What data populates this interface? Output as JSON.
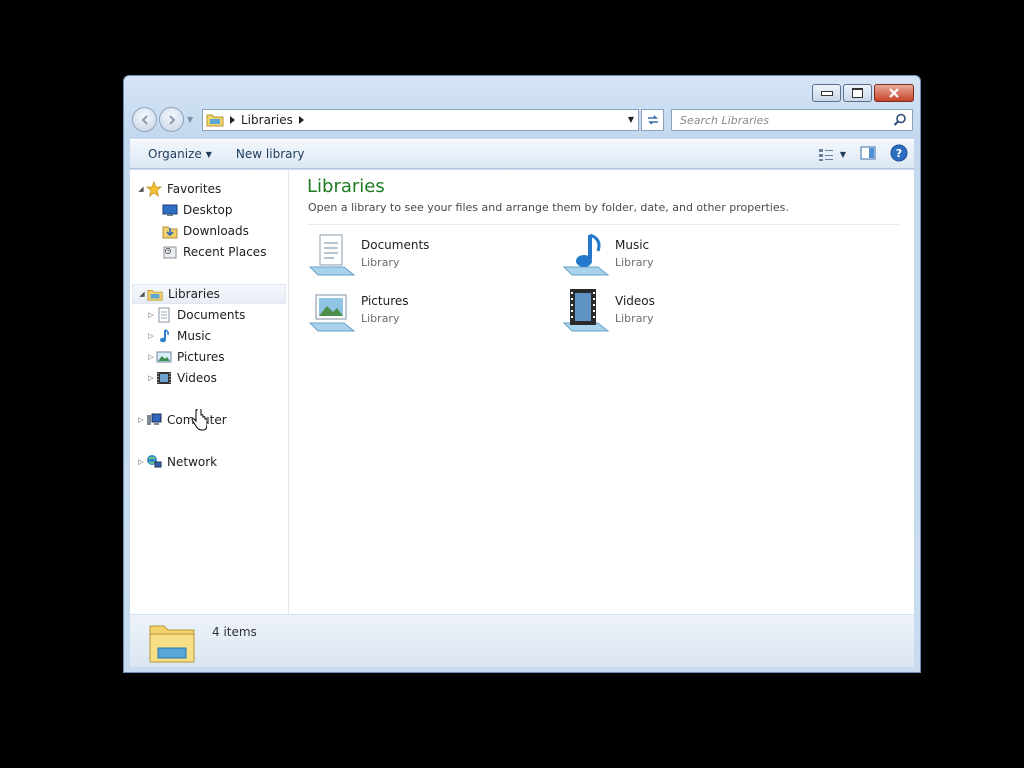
{
  "window": {
    "caption_buttons": [
      "minimize",
      "maximize",
      "close"
    ]
  },
  "address_bar": {
    "crumbs": [
      "Libraries"
    ]
  },
  "search": {
    "placeholder": "Search Libraries"
  },
  "toolbar": {
    "organize_label": "Organize",
    "new_library_label": "New library"
  },
  "nav_pane": {
    "favorites": {
      "label": "Favorites",
      "items": [
        {
          "label": "Desktop",
          "icon": "desktop-icon"
        },
        {
          "label": "Downloads",
          "icon": "downloads-icon"
        },
        {
          "label": "Recent Places",
          "icon": "recent-places-icon"
        }
      ]
    },
    "libraries": {
      "label": "Libraries",
      "items": [
        {
          "label": "Documents",
          "icon": "documents-icon"
        },
        {
          "label": "Music",
          "icon": "music-icon"
        },
        {
          "label": "Pictures",
          "icon": "pictures-icon"
        },
        {
          "label": "Videos",
          "icon": "videos-icon"
        }
      ]
    },
    "computer": {
      "label": "Computer"
    },
    "network": {
      "label": "Network"
    }
  },
  "main": {
    "title": "Libraries",
    "subtitle": "Open a library to see your files and arrange them by folder, date, and other properties.",
    "libraries": [
      {
        "name": "Documents",
        "type": "Library",
        "icon": "documents-library-icon"
      },
      {
        "name": "Music",
        "type": "Library",
        "icon": "music-library-icon"
      },
      {
        "name": "Pictures",
        "type": "Library",
        "icon": "pictures-library-icon"
      },
      {
        "name": "Videos",
        "type": "Library",
        "icon": "videos-library-icon"
      }
    ]
  },
  "status_bar": {
    "item_count": "4 items"
  },
  "colors": {
    "title_green": "#1e7b22",
    "close_red": "#c7432a",
    "frame_blue": "#c3d8ee"
  }
}
